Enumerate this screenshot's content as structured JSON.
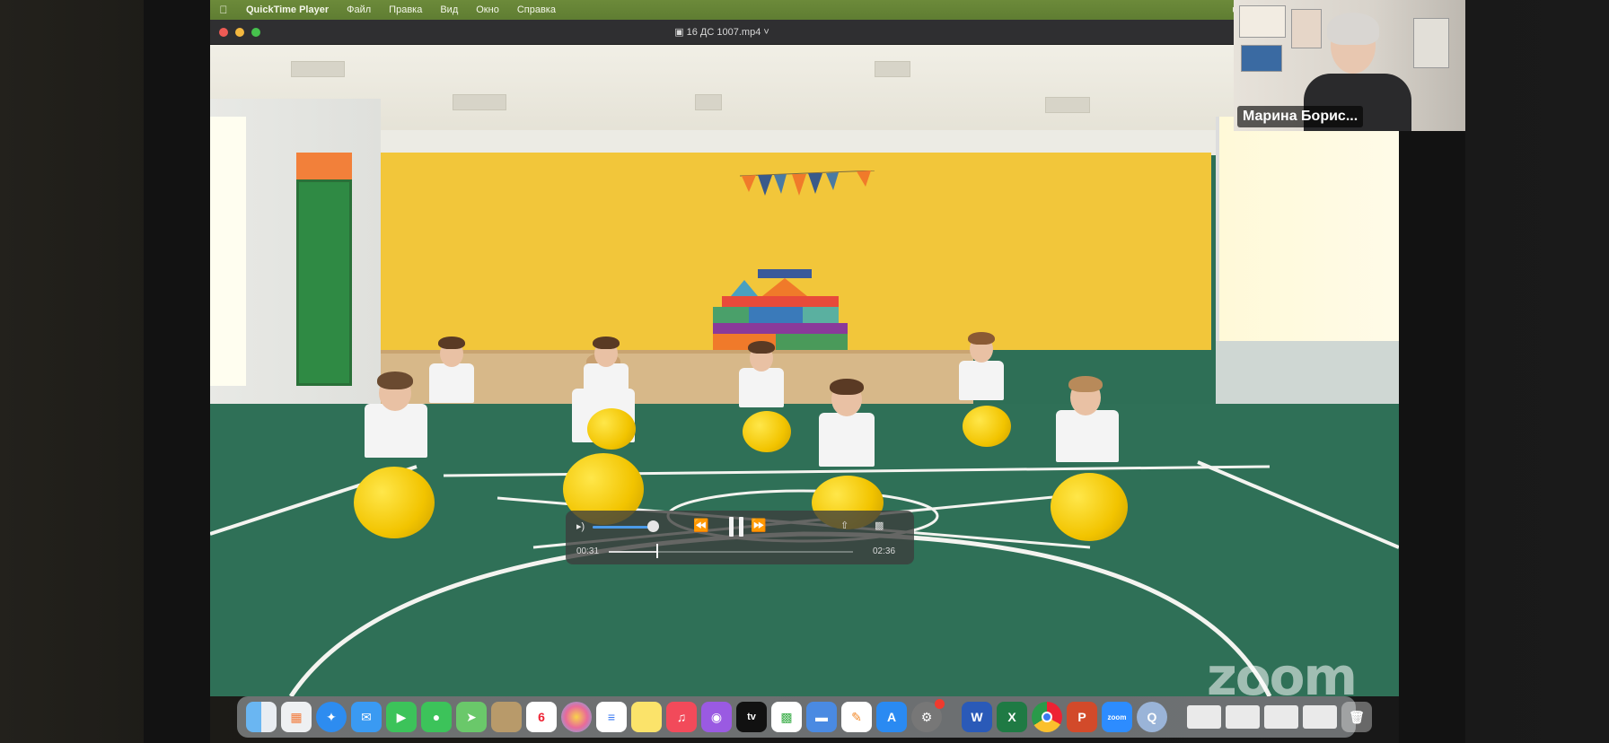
{
  "menubar": {
    "app_name": "QuickTime Player",
    "items": [
      "Файл",
      "Правка",
      "Вид",
      "Окно",
      "Справка"
    ]
  },
  "player": {
    "file_name": "16 ДС 1007.mp4",
    "elapsed": "00:31",
    "duration": "02:36",
    "playback_progress": 0.2,
    "volume_level": 0.9,
    "state": "playing"
  },
  "dock": {
    "calendar_day": "6",
    "apps": [
      "finder-icon",
      "launchpad-icon",
      "safari-icon",
      "mail-icon",
      "facetime-icon",
      "messages-icon",
      "maps-icon",
      "photos-folder-icon",
      "calendar-icon",
      "photos-icon",
      "reminders-icon",
      "notes-icon",
      "music-icon",
      "podcasts-icon",
      "apple-tv-icon",
      "numbers-icon",
      "keynote-icon",
      "pages-icon",
      "app-store-icon",
      "system-preferences-icon",
      "word-icon",
      "excel-icon",
      "chrome-icon",
      "powerpoint-icon",
      "zoom-icon",
      "quicktime-icon"
    ]
  },
  "zoom": {
    "watermark": "zoom",
    "participant_name": "Марина Борис..."
  },
  "colors": {
    "menubar": "#6c8a3a",
    "accent_blue": "#4b9be8",
    "wall_yellow": "#f2c63a",
    "floor_green": "#2f7057"
  }
}
